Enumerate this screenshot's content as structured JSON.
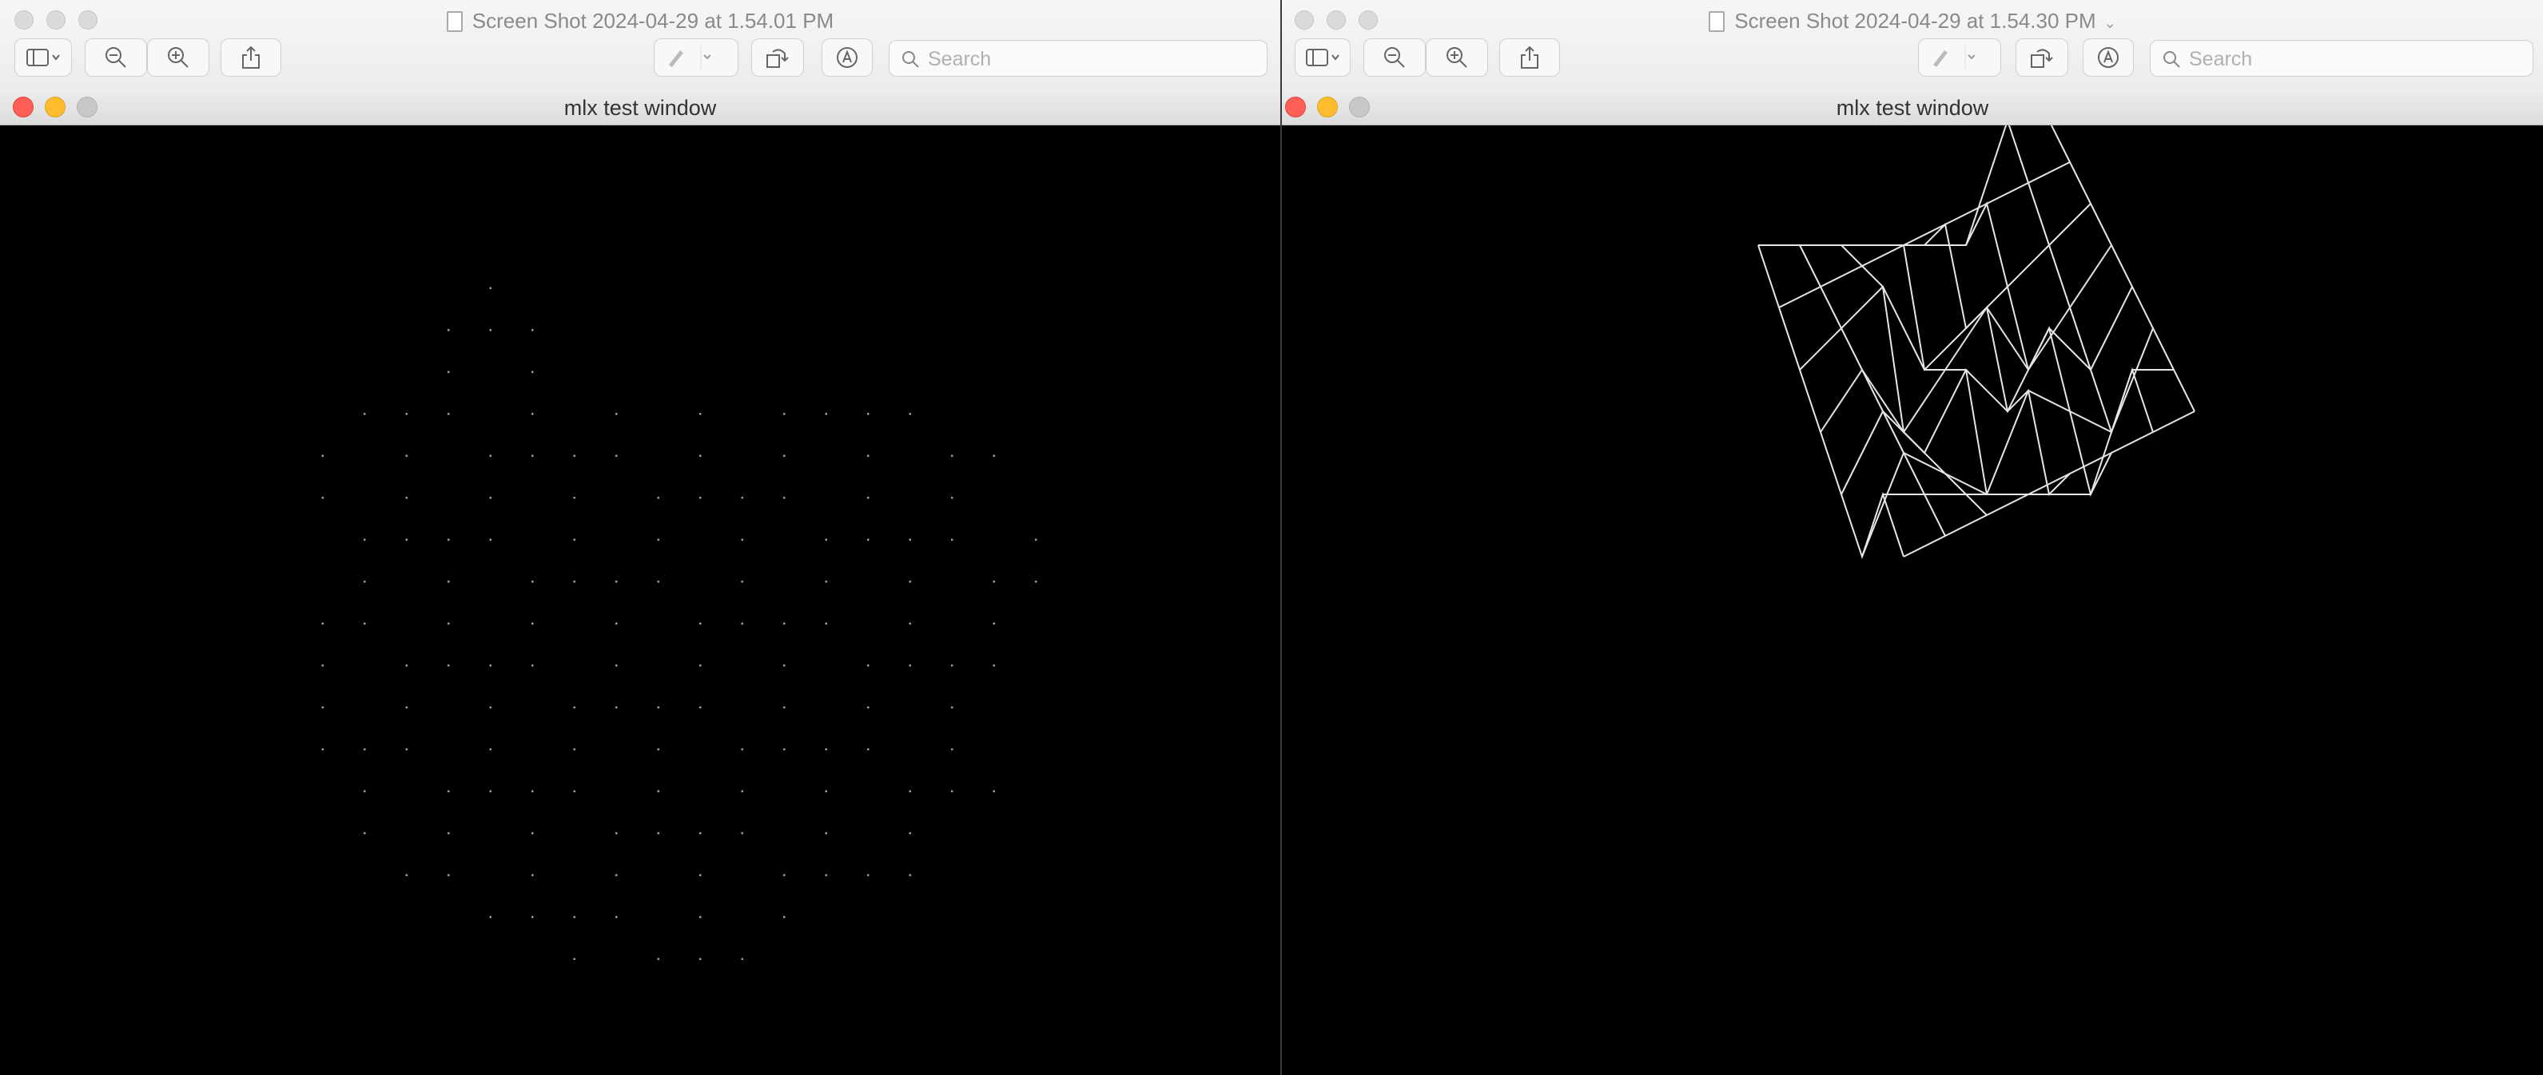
{
  "windows": [
    {
      "id": "left",
      "preview_title": "Screen Shot 2024-04-29 at 1.54.01 PM",
      "show_title_chevron": false,
      "search_placeholder": "Search",
      "search_value": "",
      "mlx_title": "mlx test window",
      "render_mode": "points"
    },
    {
      "id": "right",
      "preview_title": "Screen Shot 2024-04-29 at 1.54.30 PM",
      "show_title_chevron": true,
      "search_placeholder": "Search",
      "search_value": "",
      "mlx_title": "mlx test window",
      "render_mode": "wireframe"
    }
  ],
  "toolbar_icons": [
    "sidebar-icon",
    "zoom-out-icon",
    "zoom-in-icon",
    "share-icon",
    "markup-pen-icon",
    "chevron-down-icon",
    "rotate-icon",
    "annotate-icon",
    "search-icon"
  ],
  "colors": {
    "close": "#ff5f57",
    "minimize": "#febc2e",
    "zoom_inactive": "#c8c8c8",
    "points": "#9a9a9a",
    "wireframe": "#e6e6e6"
  }
}
